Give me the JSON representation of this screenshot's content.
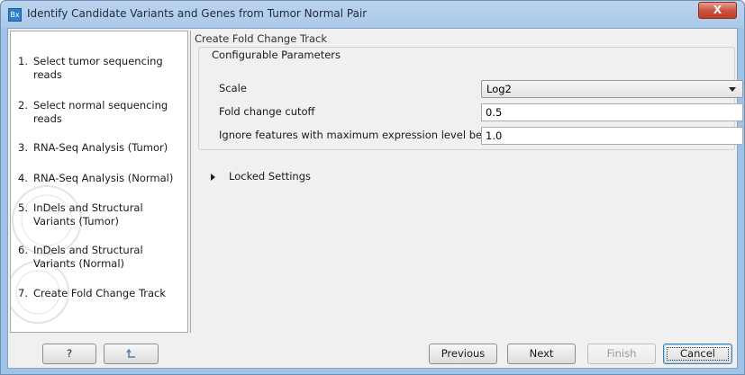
{
  "window": {
    "title": "Identify Candidate Variants and Genes from Tumor Normal Pair",
    "app_icon_text": "Bx",
    "close_glyph": "X"
  },
  "sidebar": {
    "steps": [
      {
        "num": "1.",
        "label": "Select tumor sequencing reads"
      },
      {
        "num": "2.",
        "label": "Select normal sequencing reads"
      },
      {
        "num": "3.",
        "label": "RNA-Seq Analysis (Tumor)"
      },
      {
        "num": "4.",
        "label": "RNA-Seq Analysis (Normal)"
      },
      {
        "num": "5.",
        "label": "InDels and Structural Variants (Tumor)"
      },
      {
        "num": "6.",
        "label": "InDels and Structural Variants (Normal)"
      },
      {
        "num": "7.",
        "label": "Create Fold Change Track"
      }
    ]
  },
  "main": {
    "panel_title": "Create Fold Change Track",
    "group_title": "Configurable Parameters",
    "params": {
      "scale_label": "Scale",
      "scale_value": "Log2",
      "fold_label": "Fold change cutoff",
      "fold_value": "0.5",
      "ignore_label": "Ignore features with maximum expression level below",
      "ignore_value": "1.0"
    },
    "locked_label": "Locked Settings"
  },
  "buttons": {
    "help": "?",
    "reset_icon": "reset-icon",
    "previous": "Previous",
    "next": "Next",
    "finish": "Finish",
    "cancel": "Cancel"
  },
  "colors": {
    "title_bar": "#a9c8e8",
    "close_button": "#c9503a",
    "dialog_bg": "#f0f0f0"
  }
}
